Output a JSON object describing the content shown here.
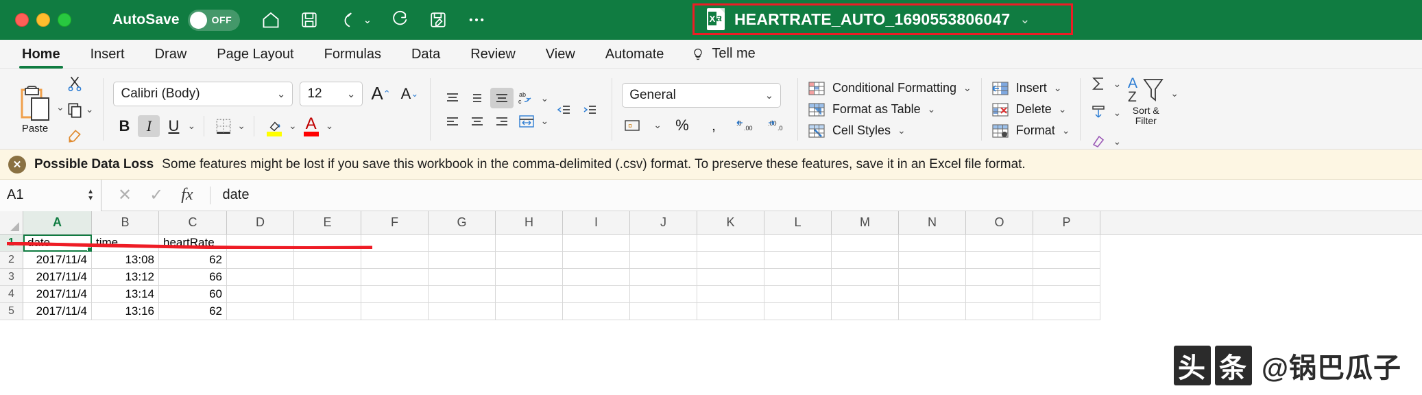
{
  "titlebar": {
    "autosave_label": "AutoSave",
    "autosave_state": "OFF",
    "filename": "HEARTRATE_AUTO_1690553806047",
    "quick_access": [
      {
        "name": "home-icon",
        "label": "Home"
      },
      {
        "name": "save-icon",
        "label": "Save"
      },
      {
        "name": "undo-icon",
        "label": "Undo"
      },
      {
        "name": "redo-icon",
        "label": "Redo"
      },
      {
        "name": "save-as-icon",
        "label": "Save As"
      },
      {
        "name": "more-icon",
        "label": "More"
      }
    ]
  },
  "tabs": [
    {
      "label": "Home",
      "active": true
    },
    {
      "label": "Insert",
      "active": false
    },
    {
      "label": "Draw",
      "active": false
    },
    {
      "label": "Page Layout",
      "active": false
    },
    {
      "label": "Formulas",
      "active": false
    },
    {
      "label": "Data",
      "active": false
    },
    {
      "label": "Review",
      "active": false
    },
    {
      "label": "View",
      "active": false
    },
    {
      "label": "Automate",
      "active": false
    }
  ],
  "tellme": {
    "label": "Tell me"
  },
  "ribbon": {
    "paste": {
      "label": "Paste"
    },
    "font": {
      "family": "Calibri (Body)",
      "size": "12",
      "grow_label": "A",
      "shrink_label": "A",
      "bold": "B",
      "italic": "I",
      "underline": "U"
    },
    "number": {
      "format": "General",
      "percent": "%",
      "comma": "‰"
    },
    "styles": [
      {
        "label": "Conditional Formatting",
        "icon": "conditional-formatting-icon"
      },
      {
        "label": "Format as Table",
        "icon": "format-as-table-icon"
      },
      {
        "label": "Cell Styles",
        "icon": "cell-styles-icon"
      }
    ],
    "cells": [
      {
        "label": "Insert",
        "icon": "insert-cells-icon"
      },
      {
        "label": "Delete",
        "icon": "delete-cells-icon"
      },
      {
        "label": "Format",
        "icon": "format-cells-icon"
      }
    ],
    "editing": {
      "sort_filter_line1": "Sort &",
      "sort_filter_line2": "Filter"
    }
  },
  "warning": {
    "title": "Possible Data Loss",
    "message": "Some features might be lost if you save this workbook in the comma-delimited (.csv) format. To preserve these features, save it in an Excel file format.",
    "close_icon": "close-icon"
  },
  "formula_bar": {
    "name_box": "A1",
    "cancel_icon": "cancel-icon",
    "confirm_icon": "confirm-icon",
    "fx_icon": "fx-icon",
    "value": "date"
  },
  "grid": {
    "columns": [
      "A",
      "B",
      "C",
      "D",
      "E",
      "F",
      "G",
      "H",
      "I",
      "J",
      "K",
      "L",
      "M",
      "N",
      "O",
      "P"
    ],
    "selected_column": "A",
    "selected_row": 1,
    "rows": [
      {
        "num": "1",
        "cells": [
          {
            "v": "date",
            "align": "left"
          },
          {
            "v": "time",
            "align": "left"
          },
          {
            "v": "heartRate",
            "align": "left"
          },
          {
            "v": "",
            "align": "left"
          }
        ]
      },
      {
        "num": "2",
        "cells": [
          {
            "v": "2017/11/4",
            "align": "right"
          },
          {
            "v": "13:08",
            "align": "right"
          },
          {
            "v": "62",
            "align": "right"
          },
          {
            "v": "",
            "align": "right"
          }
        ]
      },
      {
        "num": "3",
        "cells": [
          {
            "v": "2017/11/4",
            "align": "right"
          },
          {
            "v": "13:12",
            "align": "right"
          },
          {
            "v": "66",
            "align": "right"
          },
          {
            "v": "",
            "align": "right"
          }
        ]
      },
      {
        "num": "4",
        "cells": [
          {
            "v": "2017/11/4",
            "align": "right"
          },
          {
            "v": "13:14",
            "align": "right"
          },
          {
            "v": "60",
            "align": "right"
          },
          {
            "v": "",
            "align": "right"
          }
        ]
      },
      {
        "num": "5",
        "cells": [
          {
            "v": "2017/11/4",
            "align": "right"
          },
          {
            "v": "13:16",
            "align": "right"
          },
          {
            "v": "62",
            "align": "right"
          },
          {
            "v": "",
            "align": "right"
          }
        ]
      }
    ]
  },
  "watermark": {
    "logo_left": "头",
    "logo_right": "条",
    "text": "@锅巴瓜子"
  },
  "colors": {
    "excel_green": "#107c41",
    "annotation_red": "#ee1c25",
    "warning_bg": "#fdf6e3"
  }
}
